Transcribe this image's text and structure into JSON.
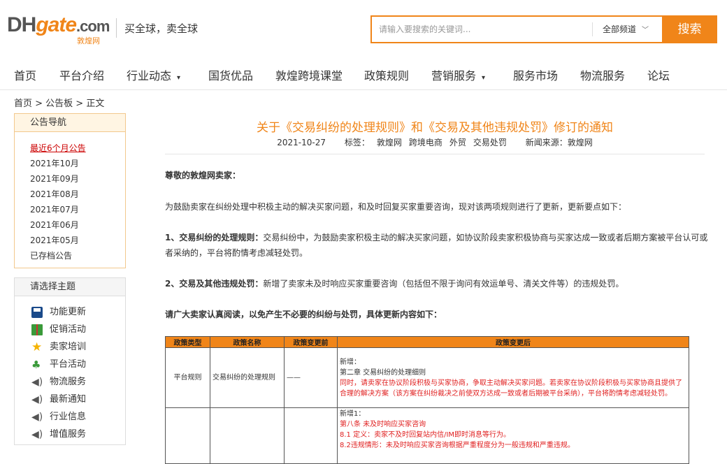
{
  "logo": {
    "dh": "DH",
    "gate": "gate",
    "com": ".com",
    "sub": "敦煌网"
  },
  "slogan": "买全球，卖全球",
  "search": {
    "placeholder": "请输入要搜索的关键词...",
    "category": "全部频道",
    "button": "搜索"
  },
  "nav": [
    {
      "label": "首页"
    },
    {
      "label": "平台介绍"
    },
    {
      "label": "行业动态",
      "dropdown": true
    },
    {
      "label": "国货优品"
    },
    {
      "label": "敦煌跨境课堂"
    },
    {
      "label": "政策规则"
    },
    {
      "label": "营销服务",
      "dropdown": true
    },
    {
      "label": "服务市场"
    },
    {
      "label": "物流服务"
    },
    {
      "label": "论坛"
    }
  ],
  "breadcrumb": "首页 > 公告板 > 正文",
  "announce_nav": {
    "title": "公告导航",
    "items": [
      "最近6个月公告",
      "2021年10月",
      "2021年09月",
      "2021年08月",
      "2021年07月",
      "2021年06月",
      "2021年05月",
      "已存档公告"
    ]
  },
  "topics": {
    "title": "请选择主题",
    "items": [
      {
        "label": "功能更新",
        "icon": "save-icon"
      },
      {
        "label": "促销活动",
        "icon": "gift-icon"
      },
      {
        "label": "卖家培训",
        "icon": "star-icon"
      },
      {
        "label": "平台活动",
        "icon": "plant-icon"
      },
      {
        "label": "物流服务",
        "icon": "speaker-icon"
      },
      {
        "label": "最新通知",
        "icon": "speaker-icon"
      },
      {
        "label": "行业信息",
        "icon": "speaker-icon"
      },
      {
        "label": "增值服务",
        "icon": "speaker-icon"
      }
    ]
  },
  "article": {
    "title": "关于《交易纠纷的处理规则》和《交易及其他违规处罚》修订的通知",
    "date": "2021-10-27",
    "tags_label": "标签：",
    "tags": [
      "敦煌网",
      "跨境电商",
      "外贸",
      "交易处罚"
    ],
    "source": "新闻来源：敦煌网",
    "greeting": "尊敬的敦煌网卖家：",
    "intro": "为鼓励卖家在纠纷处理中积极主动的解决买家问题，和及时回复买家重要咨询，现对该两项规则进行了更新，更新要点如下：",
    "point1_title": "1、交易纠纷的处理规则：",
    "point1_text": "交易纠纷中，为鼓励卖家积极主动的解决买家问题，如协议阶段卖家积极协商与买家达成一致或者后期方案被平台认可或者采纳的，平台将酌情考虑减轻处罚。",
    "point2_title": "2、交易及其他违规处罚：",
    "point2_text": "新增了卖家未及时响应买家重要咨询（包括但不限于询问有效运单号、清关文件等）的违规处罚。",
    "notice": "请广大卖家认真阅读，以免产生不必要的纠纷与处罚，具体更新内容如下："
  },
  "table": {
    "headers": [
      "政策类型",
      "政策名称",
      "政策变更前",
      "政策变更后"
    ],
    "rows": [
      {
        "type": "平台规则",
        "name": "交易纠纷的处理规则",
        "before": "——",
        "after": [
          {
            "text": "新增：",
            "red": false
          },
          {
            "text": "第二章 交易纠纷的处理细则",
            "red": false
          },
          {
            "text": "同时，请卖家在协议阶段积极与买家协商，争取主动解决买家问题。若卖家在协议阶段积极与买家协商且提供了合理的解决方案（该方案在纠纷裁决之前使双方达成一致或者后期被平台采纳），平台将酌情考虑减轻处罚。",
            "red": true
          }
        ]
      },
      {
        "type": "",
        "name": "",
        "before": "",
        "after": [
          {
            "text": "新增1：",
            "red": false
          },
          {
            "text": "第八条 未及时响应买家咨询",
            "red": true
          },
          {
            "text": "8.1 定义：卖家不及时回复站内信/IM即时消息等行为。",
            "red": true
          },
          {
            "text": "8.2违规情形：未及时响应买家咨询根据严重程度分为一般违规和严重违规。",
            "red": true
          }
        ]
      }
    ]
  }
}
